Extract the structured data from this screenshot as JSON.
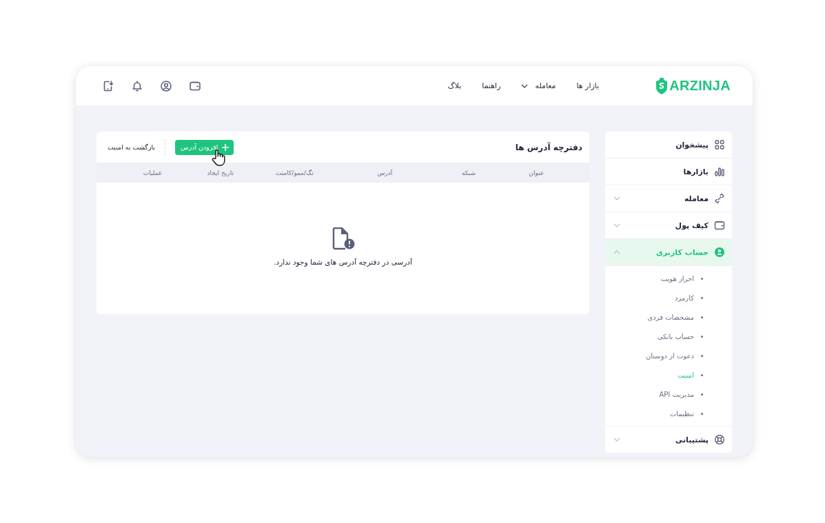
{
  "header": {
    "logo": "ARZINJA",
    "nav": [
      {
        "label": "بازار ها",
        "has_dropdown": false
      },
      {
        "label": "معامله",
        "has_dropdown": true
      },
      {
        "label": "راهنما",
        "has_dropdown": false
      },
      {
        "label": "بلاگ",
        "has_dropdown": false
      }
    ],
    "icons": [
      {
        "kind": "wallet"
      },
      {
        "kind": "user"
      },
      {
        "kind": "bell"
      },
      {
        "kind": "download-app"
      }
    ]
  },
  "sidebar": {
    "items": [
      {
        "kind": "dashboard",
        "label": "پیشخوان",
        "expandable": false,
        "selected": false
      },
      {
        "kind": "markets",
        "label": "بازارها",
        "expandable": false,
        "selected": false
      },
      {
        "kind": "trade",
        "label": "معامله",
        "expandable": true,
        "expanded": false,
        "selected": false
      },
      {
        "kind": "wallet",
        "label": "کیف پول",
        "expandable": true,
        "expanded": false,
        "selected": false
      },
      {
        "kind": "account",
        "label": "حساب کاربری",
        "expandable": true,
        "expanded": true,
        "selected": true,
        "children": [
          {
            "label": "احراز هویت",
            "selected": false
          },
          {
            "label": "کارمزد",
            "selected": false
          },
          {
            "label": "مشخصات فردی",
            "selected": false
          },
          {
            "label": "حساب بانکی",
            "selected": false
          },
          {
            "label": "دعوت از دوستان",
            "selected": false
          },
          {
            "label": "امنیت",
            "selected": true
          },
          {
            "label": "مدیریت API",
            "selected": false
          },
          {
            "label": "تنظیمات",
            "selected": false
          }
        ]
      },
      {
        "kind": "support",
        "label": "پشتیبانی",
        "expandable": true,
        "expanded": false,
        "selected": false
      }
    ]
  },
  "address_book": {
    "title": "دفترچه آدرس ها",
    "add_button": "افزودن آدرس",
    "back_link": "بازگشت به امنیت",
    "table": {
      "columns": [
        "عنوان",
        "شبکه",
        "آدرس",
        "تگ/ممو/کامنت",
        "تاریخ ایجاد",
        "عملیات"
      ]
    },
    "empty_message": "آدرسی در دفترچه آدرس های شما وجود ندارد."
  }
}
